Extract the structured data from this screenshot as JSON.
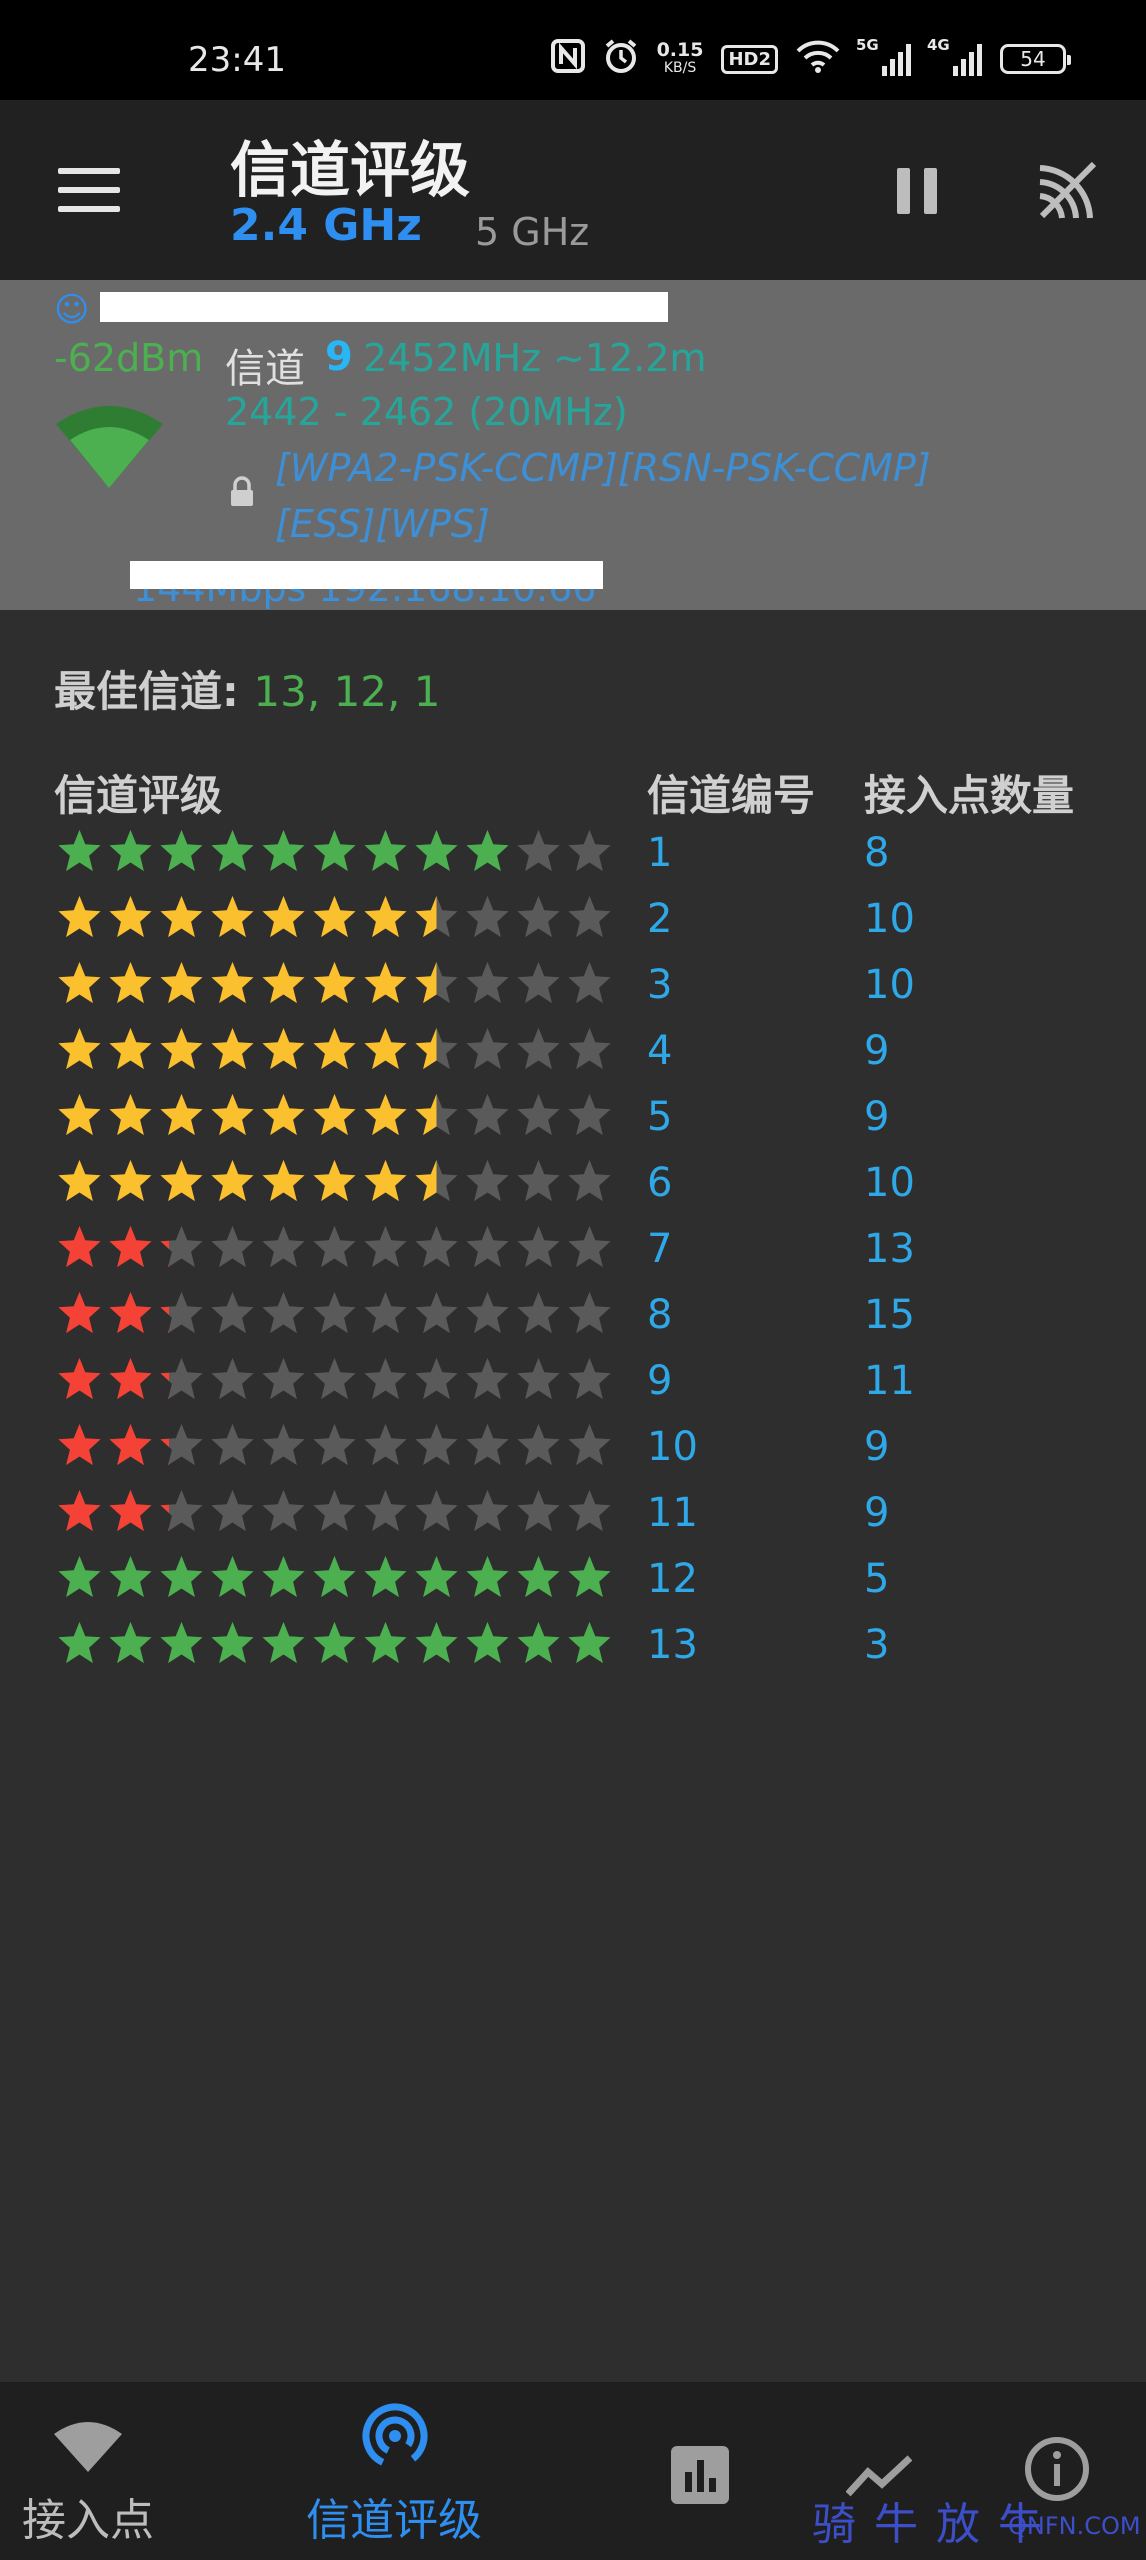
{
  "status_bar": {
    "time": "23:41",
    "nfc_icon": "nfc-icon",
    "alarm_icon": "alarm-icon",
    "net_speed_value": "0.15",
    "net_speed_unit": "KB/S",
    "hd_badge": "HD2",
    "sig1_label": "5G",
    "sig2_label": "4G",
    "battery": "54"
  },
  "app_bar": {
    "title": "信道评级",
    "band_selected": "2.4 GHz",
    "band_other": "5 GHz"
  },
  "connected_ap": {
    "rssi": "-62dBm",
    "channel_label": "信道",
    "channel": "9",
    "freq_info": "2452MHz ~12.2m",
    "freq_range": "2442 - 2462 (20MHz)",
    "security_line1": "[WPA2-PSK-CCMP][RSN-PSK-CCMP]",
    "security_line2": "[ESS][WPS]",
    "rate_partial": "144Mbps 192.168.10.66"
  },
  "best_channels": {
    "label": "最佳信道: ",
    "value": "13, 12, 1"
  },
  "table": {
    "col_rating": "信道评级",
    "col_channel": "信道编号",
    "col_ap_count": "接入点数量",
    "max_stars": 11,
    "rows": [
      {
        "channel": "1",
        "ap_count": "8",
        "stars": 9,
        "color": "#4caf50"
      },
      {
        "channel": "2",
        "ap_count": "10",
        "stars": 7.5,
        "color": "#fbc02d"
      },
      {
        "channel": "3",
        "ap_count": "10",
        "stars": 7.5,
        "color": "#fbc02d"
      },
      {
        "channel": "4",
        "ap_count": "9",
        "stars": 7.5,
        "color": "#fbc02d"
      },
      {
        "channel": "5",
        "ap_count": "9",
        "stars": 7.5,
        "color": "#fbc02d"
      },
      {
        "channel": "6",
        "ap_count": "10",
        "stars": 7.5,
        "color": "#fbc02d"
      },
      {
        "channel": "7",
        "ap_count": "13",
        "stars": 2.2,
        "color": "#f44336"
      },
      {
        "channel": "8",
        "ap_count": "15",
        "stars": 2.2,
        "color": "#f44336"
      },
      {
        "channel": "9",
        "ap_count": "11",
        "stars": 2.2,
        "color": "#f44336"
      },
      {
        "channel": "10",
        "ap_count": "9",
        "stars": 2.2,
        "color": "#f44336"
      },
      {
        "channel": "11",
        "ap_count": "9",
        "stars": 2.2,
        "color": "#f44336"
      },
      {
        "channel": "12",
        "ap_count": "5",
        "stars": 11,
        "color": "#4caf50"
      },
      {
        "channel": "13",
        "ap_count": "3",
        "stars": 11,
        "color": "#4caf50"
      }
    ]
  },
  "bottom_nav": {
    "items": [
      {
        "label": "接入点",
        "icon": "wifi-icon"
      },
      {
        "label": "信道评级",
        "icon": "channel-rating-icon"
      },
      {
        "label": "",
        "icon": "bar-chart-icon"
      },
      {
        "label": "",
        "icon": "line-graph-icon"
      },
      {
        "label": "",
        "icon": "info-icon"
      }
    ]
  },
  "watermark": {
    "text": "骑牛放牛",
    "domain": "QNFN.COM"
  },
  "colors": {
    "accent_blue": "#2f8ff0",
    "good_green": "#4caf50",
    "mid_yellow": "#fbc02d",
    "bad_red": "#f44336",
    "empty_star": "#5a5a5a"
  }
}
